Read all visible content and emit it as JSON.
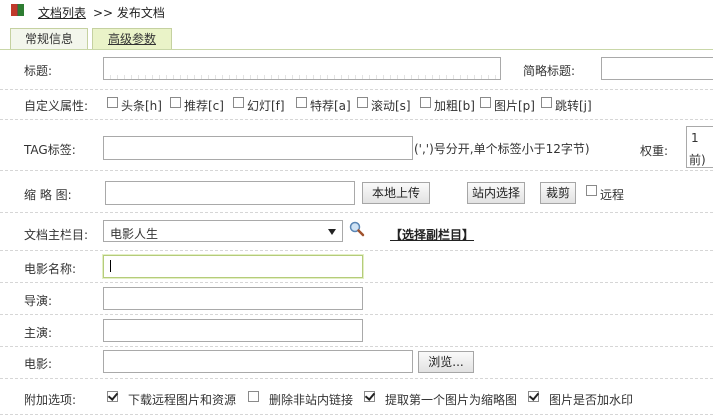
{
  "breadcrumb": {
    "link": "文档列表",
    "sep_current": ">> 发布文档"
  },
  "tabs": [
    {
      "label": "常规信息"
    },
    {
      "label": "高级参数"
    }
  ],
  "fields": {
    "title_label": "标题:",
    "short_title_label": "简略标题:",
    "custom_attr_label": "自定义属性:",
    "attrs": [
      "头条[h]",
      "推荐[c]",
      "幻灯[f]",
      "特荐[a]",
      "滚动[s]",
      "加粗[b]",
      "图片[p]",
      "跳转[j]"
    ],
    "tag_label": "TAG标签:",
    "tag_hint": "(',')号分开,单个标签小于12字节)",
    "weight_label": "权重:",
    "weight_value": "1",
    "weight_suffix": "前)",
    "thumb_label": "缩 略 图:",
    "upload_btn": "本地上传",
    "site_select_btn": "站内选择",
    "crop_btn": "裁剪",
    "remote_label": "远程",
    "column_label": "文档主栏目:",
    "column_value": "电影人生",
    "sub_column_link": "【选择副栏目】",
    "movie_name_label": "电影名称:",
    "director_label": "导演:",
    "actor_label": "主演:",
    "movie_label": "电影:",
    "browse_btn": "浏览...",
    "extra_label": "附加选项:",
    "extras": [
      {
        "label": "下载远程图片和资源",
        "checked": true
      },
      {
        "label": "删除非站内链接",
        "checked": false
      },
      {
        "label": "提取第一个图片为缩略图",
        "checked": true
      },
      {
        "label": "图片是否加水印",
        "checked": true
      }
    ]
  },
  "colors": {
    "tab_active": "#eaf3c8",
    "focus_border": "#b5cc7a"
  }
}
